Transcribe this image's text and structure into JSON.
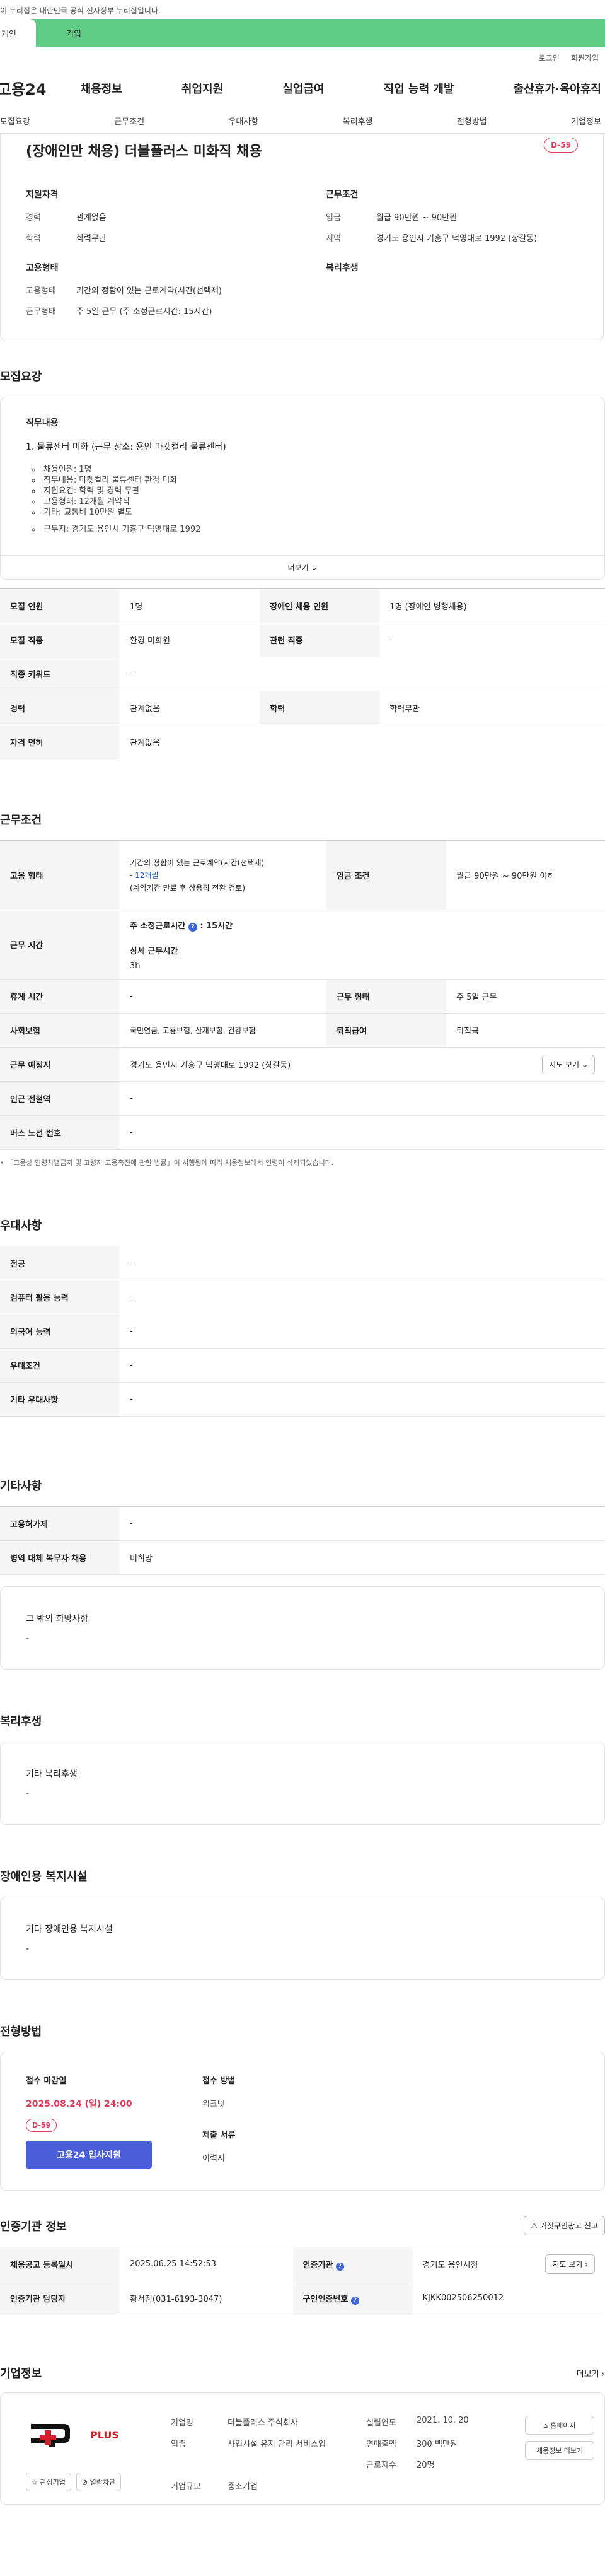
{
  "gov_bar": "이 누리집은 대한민국 공식 전자정부 누리집입니다.",
  "tabs": {
    "person": "개인",
    "company": "기업"
  },
  "util_links": [
    "로그인",
    "회원가입"
  ],
  "logo": "고용24",
  "gnb": [
    "채용정보",
    "취업지원",
    "실업급여",
    "직업 능력 개발",
    "출산휴가·육아휴직"
  ],
  "subnav": [
    "모집요강",
    "근무조건",
    "우대사항",
    "복리후생",
    "전형방법",
    "기업정보"
  ],
  "title": "(장애인만 채용) 더블플러스 미화직 채용",
  "dday": "D-59",
  "summary": {
    "qual_title": "지원자격",
    "qual": [
      {
        "k": "경력",
        "v": "관계없음"
      },
      {
        "k": "학력",
        "v": "학력무관"
      }
    ],
    "cond_title": "근무조건",
    "cond": [
      {
        "k": "임금",
        "v": "월급 90만원 ~ 90만원"
      },
      {
        "k": "지역",
        "v": "경기도 용인시 기흥구 덕영대로 1992 (상갈동)"
      }
    ],
    "emp_title": "고용형태",
    "emp": [
      {
        "k": "고용형태",
        "v": "기간의 정함이 있는 근로계약(시간(선택제)"
      },
      {
        "k": "근무형태",
        "v": "주 5일 근무 (주 소정근로시간: 15시간)"
      }
    ],
    "welfare_title": "복리후생"
  },
  "recruit": {
    "section": "모집요강",
    "duty_title": "직무내용",
    "line1": "1. 물류센터 미화 (근무 장소: 용인  마켓컬리 물류센터)",
    "bullets": [
      "채용인원:  1명",
      "직무내용: 마켓컬리 물류센터 환경 미화",
      "지원요건: 학력 및 경력 무관",
      "고용형태: 12개월 계약직",
      "기타: 교통비 10만원 별도",
      "근무지:  경기도 용인시 기흥구 덕영대로 1992"
    ],
    "more": "더보기"
  },
  "recruit_table": [
    [
      "모집 인원",
      "1명",
      "장애인 채용 인원",
      "1명 (장애인 병행채용)"
    ],
    [
      "모집 직종",
      "환경 미화원",
      "관련 직종",
      "-"
    ],
    [
      "직종 키워드",
      "-",
      "",
      ""
    ],
    [
      "경력",
      "관계없음",
      "학력",
      "학력무관"
    ],
    [
      "자격 면허",
      "관계없음",
      "",
      ""
    ]
  ],
  "work": {
    "section": "근무조건",
    "emp_type_label": "고용 형태",
    "emp_type_1": "기간의 정함이 있는 근로계약(시간(선택제)",
    "emp_type_2": "- 12개월",
    "emp_type_3": "(계약기간 만료 후 상용직 전환 검토)",
    "wage_label": "임금 조건",
    "wage": "월급 90만원 ~ 90만원 이하",
    "hours_label": "근무 시간",
    "hours_week": "주 소정근로시간",
    "hours_week_val": ": 15시간",
    "hours_detail_title": "상세 근무시간",
    "hours_detail": "3h",
    "break_label": "휴게 시간",
    "break_val": "-",
    "form_label": "근무 형태",
    "form_val": "주 5일 근무",
    "insurance_label": "사회보험",
    "insurance_val": "국민연금, 고용보험, 산재보험, 건강보험",
    "retire_label": "퇴직급여",
    "retire_val": "퇴직금",
    "place_label": "근무 예정지",
    "place_val": "경기도 용인시 기흥구 덕영대로 1992 (상갈동)",
    "map_btn": "지도 보기",
    "station_label": "인근 전철역",
    "station_val": "-",
    "bus_label": "버스 노선 번호",
    "bus_val": "-",
    "note": "「고용상 연령차별금지 및 고령자 고용촉진에 관한 법률」이 시행됨에 따라 채용정보에서 연령이 삭제되었습니다."
  },
  "pref": {
    "section": "우대사항",
    "rows": [
      [
        "전공",
        "-"
      ],
      [
        "컴퓨터 활용 능력",
        "-"
      ],
      [
        "외국어 능력",
        "-"
      ],
      [
        "우대조건",
        "-"
      ],
      [
        "기타 우대사항",
        "-"
      ]
    ]
  },
  "etc": {
    "section": "기타사항",
    "rows": [
      [
        "고용허가제",
        "-"
      ],
      [
        "병역 대체 복무자 채용",
        "비희망"
      ]
    ],
    "other_title": "그 밖의 희망사항",
    "other_val": "-"
  },
  "welfare": {
    "section": "복리후생",
    "title": "기타 복리후생",
    "val": "-"
  },
  "facility": {
    "section": "장애인용 복지시설",
    "title": "기타 장애인용 복지시설",
    "val": "-"
  },
  "apply": {
    "section": "전형방법",
    "deadline_label": "접수 마감일",
    "deadline": "2025.08.24 (일) 24:00",
    "dday": "D-59",
    "apply_btn": "고용24 입사지원",
    "method_label": "접수 방법",
    "method": "워크넷",
    "docs_label": "제출 서류",
    "docs": "이력서"
  },
  "cert": {
    "section": "인증기관 정보",
    "report_btn": "거짓구인광고 신고",
    "rows": [
      [
        "채용공고 등록일시",
        "2025.06.25 14:52:53",
        "인증기관",
        "경기도 용인시청"
      ],
      [
        "인증기관 담당자",
        "황서정(031-6193-3047)",
        "구인인증번호",
        "KJKK002506250012"
      ]
    ],
    "map_btn": "지도 보기"
  },
  "company": {
    "section": "기업정보",
    "more": "더보기",
    "logo_plus": "PLUS",
    "fav_btn": "관심기업",
    "block_btn": "열람차단",
    "name_label": "기업명",
    "name": "더블플러스 주식회사",
    "found_label": "설립연도",
    "found": "2021. 10. 20",
    "industry_label": "업종",
    "industry": "사업시설 유지 관리 서비스업",
    "sales_label": "연매출액",
    "sales": "300 백만원",
    "employees_label": "근로자수",
    "employees": "20명",
    "size_label": "기업규모",
    "size": "중소기업",
    "homepage_btn": "홈페이지",
    "jobs_btn": "채용정보 더보기"
  }
}
